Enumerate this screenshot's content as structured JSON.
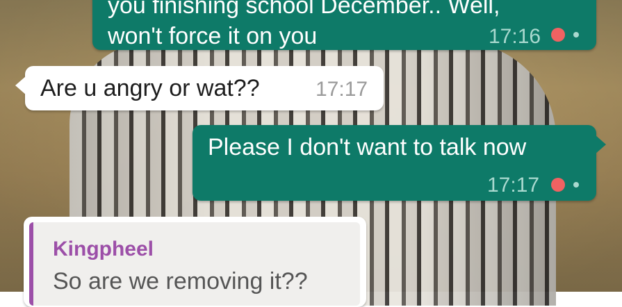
{
  "chat": {
    "messages": [
      {
        "direction": "outgoing",
        "lines": [
          "you finishing school December.. Well,",
          "won't force it on you"
        ],
        "time": "17:16",
        "status_icon": "message-status-dot"
      },
      {
        "direction": "incoming",
        "text": "Are u angry or wat??",
        "time": "17:17"
      },
      {
        "direction": "outgoing",
        "text": "Please I don't want to talk now",
        "time": "17:17",
        "status_icon": "message-status-dot"
      },
      {
        "direction": "incoming",
        "quoted": {
          "author": "Kingpheel",
          "text": "So are we removing it??"
        }
      }
    ]
  },
  "colors": {
    "outgoing_bubble": "#0e7a68",
    "incoming_bubble": "#ffffff",
    "status_dot": "#f06262",
    "quote_author": "#9c4fa8"
  }
}
